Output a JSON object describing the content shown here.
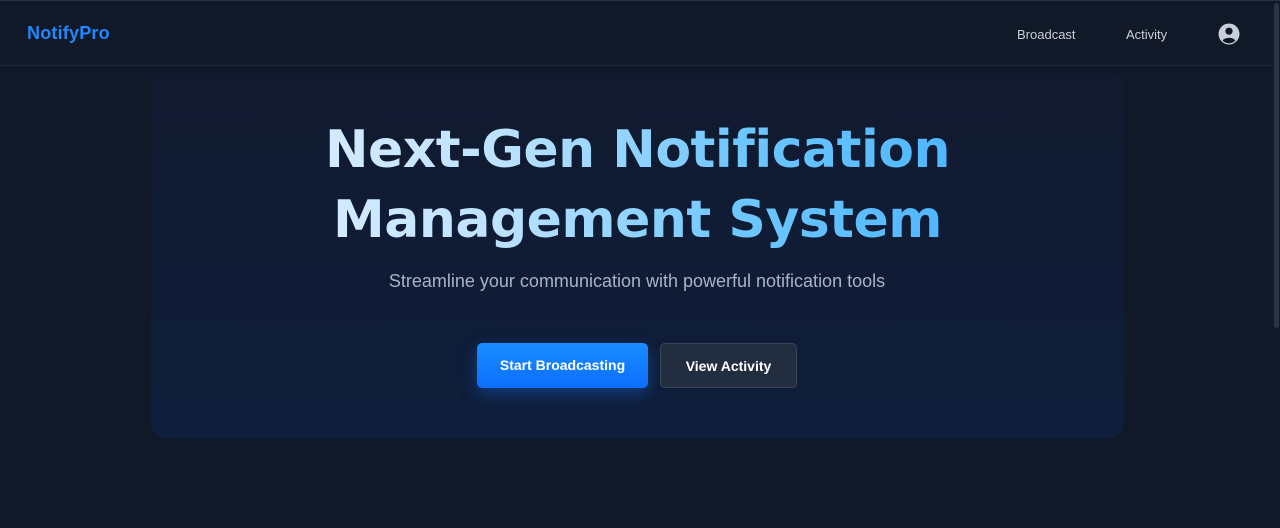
{
  "navbar": {
    "brand": "NotifyPro",
    "links": [
      {
        "label": "Broadcast"
      },
      {
        "label": "Activity"
      }
    ],
    "profile_icon": "user-circle-icon"
  },
  "hero": {
    "title": "Next-Gen Notification Management System",
    "subtitle": "Streamline your communication with powerful notification tools",
    "primary_button": "Start Broadcasting",
    "secondary_button": "View Activity"
  },
  "colors": {
    "background": "#111827",
    "brand": "#1e88ff",
    "primary_button": "#0b6fff",
    "secondary_button": "#232d40",
    "title_gradient_start": "#e6f3ff",
    "title_gradient_end": "#36a9ff"
  }
}
